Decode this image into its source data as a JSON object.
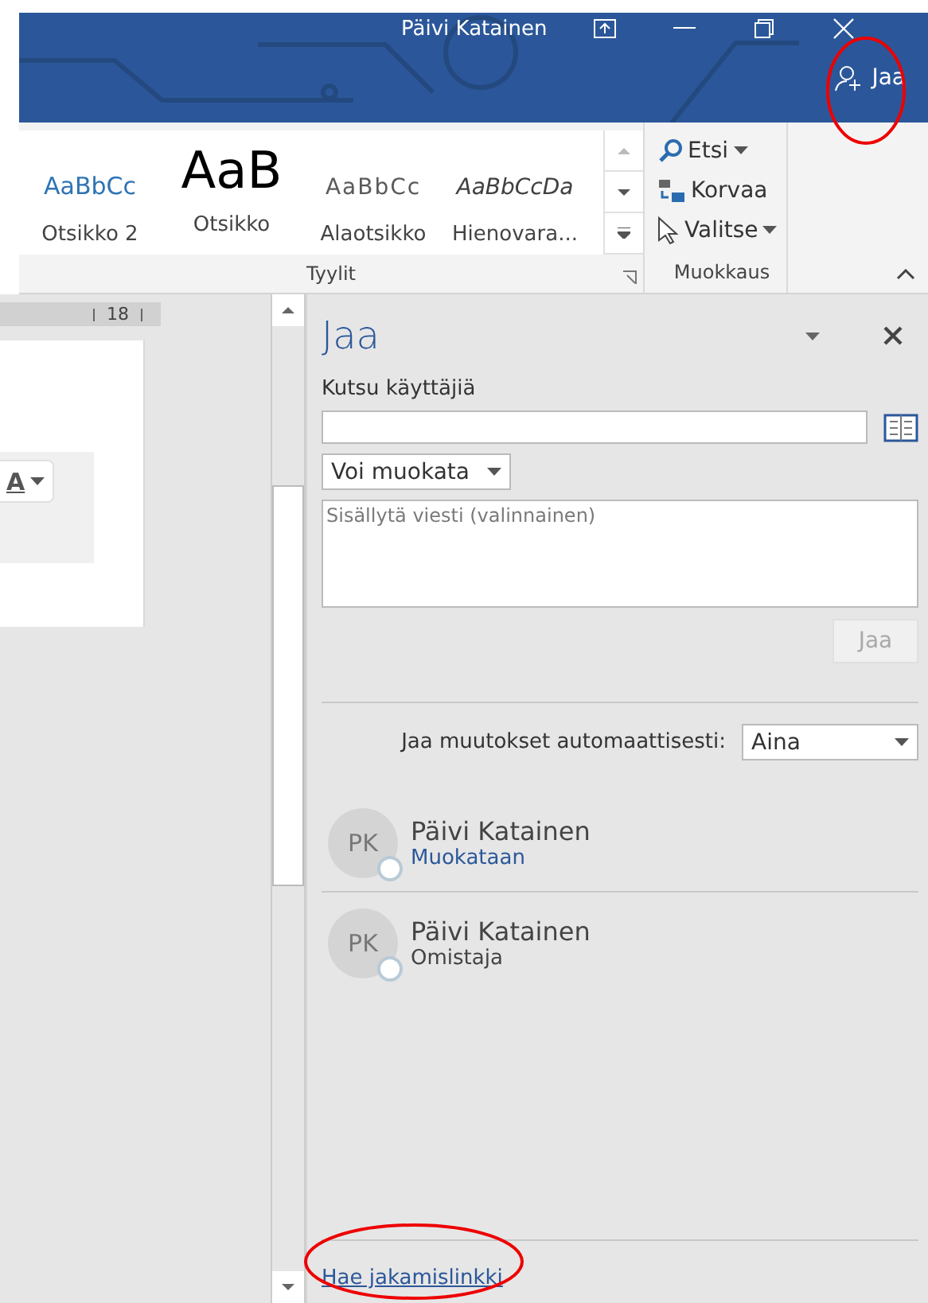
{
  "window": {
    "title": "Päivi Katainen",
    "share_button": {
      "label": "Jaa",
      "highlighted": true
    }
  },
  "ribbon": {
    "styles": [
      {
        "sample": "AaBbCc",
        "label": "Otsikko 2",
        "kind": "heading2"
      },
      {
        "sample": "AaB",
        "label": "Otsikko",
        "kind": "title"
      },
      {
        "sample": "AaBbCc",
        "label": "Alaotsikko",
        "kind": "subtitle"
      },
      {
        "sample": "AaBbCcDa",
        "label": "Hienovara...",
        "kind": "subtle"
      }
    ],
    "styles_group": "Tyylit",
    "editing": [
      {
        "label": "Etsi",
        "kind": "find",
        "has_menu": true
      },
      {
        "label": "Korvaa",
        "kind": "replace",
        "has_menu": false
      },
      {
        "label": "Valitse",
        "kind": "select",
        "has_menu": true
      }
    ],
    "editing_group": "Muokkaus"
  },
  "document": {
    "ruler_label": "18",
    "format_button": "A"
  },
  "panel": {
    "title": "Jaa",
    "invite_label": "Kutsu käyttäjiä",
    "permission": "Voi muokata",
    "message_placeholder": "Sisällytä viesti (valinnainen)",
    "send_button": {
      "label": "Jaa",
      "disabled": true
    },
    "auto_share": {
      "label": "Jaa muutokset automaattisesti:",
      "value": "Aina"
    },
    "people": [
      {
        "initials": "PK",
        "name": "Päivi Katainen",
        "role": "Muokataan",
        "kind": "link"
      },
      {
        "initials": "PK",
        "name": "Päivi Katainen",
        "role": "Omistaja",
        "kind": "text"
      }
    ],
    "link": {
      "label": "Hae jakamislinkki",
      "highlighted": true
    }
  }
}
